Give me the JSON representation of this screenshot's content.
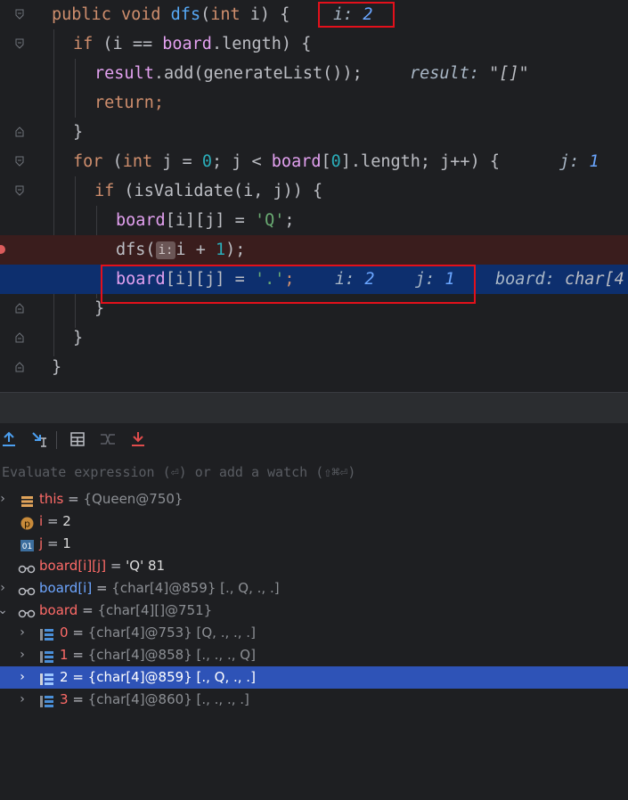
{
  "code": {
    "line1": {
      "kw1": "public",
      "kw2": "void",
      "fn": "dfs",
      "open": "(",
      "kw3": "int",
      "param": " i) {",
      "hint_label": "i:",
      "hint_value": "2"
    },
    "line2": {
      "kw": "if",
      "a": " (i == ",
      "ref": "board",
      "b": ".length) {"
    },
    "line3": {
      "ref": "result",
      "a": ".add(generateList());",
      "hint_label": "result:",
      "hint_value": "\"[]\""
    },
    "line4": {
      "kw": "return",
      "a": ";"
    },
    "line5": {
      "a": "}"
    },
    "line6": {
      "kw": "for",
      "a": " (",
      "kw2": "int",
      "b": " j = ",
      "n0": "0",
      "c": "; j < ",
      "ref": "board",
      "d": "[",
      "n1": "0",
      "e": "].length; j++) {",
      "hint_label": "j:",
      "hint_value": "1"
    },
    "line7": {
      "kw": "if",
      "a": " (isValidate(i, j)) {"
    },
    "line8": {
      "ref": "board",
      "a": "[i][j] = ",
      "str": "'Q'",
      "b": ";"
    },
    "line9": {
      "a": "dfs(",
      "param_hint": "i:",
      "b": "i + ",
      "num": "1",
      "c": ");"
    },
    "line10": {
      "ref": "board",
      "a": "[i][j] = ",
      "str": "'.'",
      "b": ";",
      "h1_label": "i:",
      "h1_value": "2",
      "h2_label": "j:",
      "h2_value": "1",
      "h3_label": "board:",
      "h3_value": "char[4"
    },
    "line11": {
      "a": "}"
    },
    "line12": {
      "a": "}"
    },
    "line13": {
      "a": "}"
    }
  },
  "evaluate": {
    "placeholder": "Evaluate expression (⏎) or add a watch (⇧⌘⏎)"
  },
  "variables": [
    {
      "name": "this",
      "eq": " = ",
      "value": "{Queen@750}",
      "icon": "field-icon"
    },
    {
      "name": "i",
      "eq": " = ",
      "value": "2",
      "icon": "parameter-icon"
    },
    {
      "name": "j",
      "eq": " = ",
      "value": "1",
      "icon": "local-variable-icon"
    },
    {
      "name": "board[i][j]",
      "eq": " = ",
      "value": "'Q' 81",
      "icon": "watch-icon"
    },
    {
      "name": "board[i]",
      "eq": " = ",
      "value": "{char[4]@859} [., Q, ., .]",
      "icon": "watch-icon"
    },
    {
      "name": "board",
      "eq": " = ",
      "value": "{char[4][]@751}",
      "icon": "watch-icon"
    },
    {
      "name": "0",
      "eq": " = ",
      "value": "{char[4]@753} [Q, ., ., .]",
      "icon": "array-icon"
    },
    {
      "name": "1",
      "eq": " = ",
      "value": "{char[4]@858} [., ., ., Q]",
      "icon": "array-icon"
    },
    {
      "name": "2",
      "eq": " = ",
      "value": "{char[4]@859} [., Q, ., .]",
      "icon": "array-icon"
    },
    {
      "name": "3",
      "eq": " = ",
      "value": "{char[4]@860} [., ., ., .]",
      "icon": "array-icon"
    }
  ],
  "colors": {
    "breakpoint_line": "#3a1d1d",
    "execution_line": "#0d2f6e",
    "selection": "#2e53b7",
    "highlight_box": "#e3101b"
  }
}
